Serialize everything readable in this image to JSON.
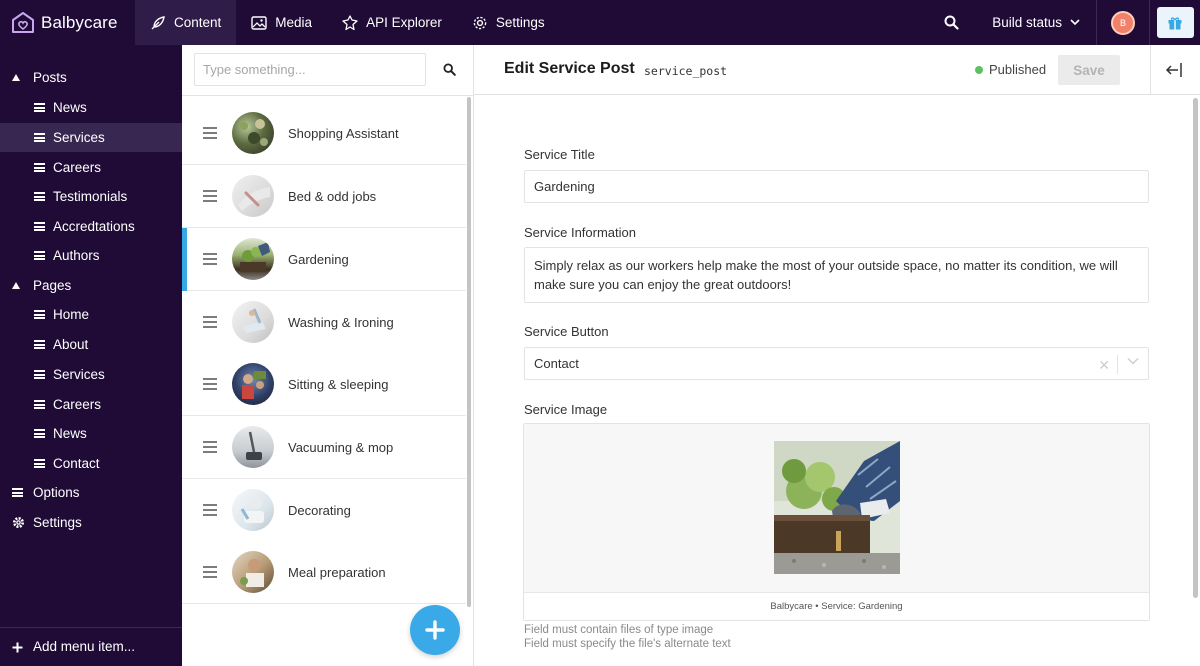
{
  "app": {
    "name": "Balbycare",
    "brand_color": "#1f0b36",
    "accent": "#36a8e6"
  },
  "topnav": [
    {
      "label": "Content",
      "icon": "feather-icon",
      "active": true
    },
    {
      "label": "Media",
      "icon": "image-icon"
    },
    {
      "label": "API Explorer",
      "icon": "api-explorer-icon"
    },
    {
      "label": "Settings",
      "icon": "gear-icon"
    }
  ],
  "topright": {
    "build_status": "Build status",
    "avatar_initial": "B"
  },
  "sidebar": {
    "items": [
      {
        "label": "Posts",
        "type": "group"
      },
      {
        "label": "News",
        "type": "child"
      },
      {
        "label": "Services",
        "type": "child",
        "active": true
      },
      {
        "label": "Careers",
        "type": "child"
      },
      {
        "label": "Testimonials",
        "type": "child"
      },
      {
        "label": "Accredtations",
        "type": "child"
      },
      {
        "label": "Authors",
        "type": "child"
      },
      {
        "label": "Pages",
        "type": "group"
      },
      {
        "label": "Home",
        "type": "child"
      },
      {
        "label": "About",
        "type": "child"
      },
      {
        "label": "Services",
        "type": "child"
      },
      {
        "label": "Careers",
        "type": "child"
      },
      {
        "label": "News",
        "type": "child"
      },
      {
        "label": "Contact",
        "type": "child"
      },
      {
        "label": "Options",
        "type": "top"
      },
      {
        "label": "Settings",
        "type": "top-gear"
      }
    ],
    "footer": "Add menu item..."
  },
  "list": {
    "search_placeholder": "Type something...",
    "items": [
      {
        "title": "Shopping Assistant"
      },
      {
        "title": "Bed & odd jobs"
      },
      {
        "title": "Gardening",
        "selected": true
      },
      {
        "title": "Washing & Ironing"
      },
      {
        "title": "Sitting & sleeping"
      },
      {
        "title": "Vacuuming & mop"
      },
      {
        "title": "Decorating"
      },
      {
        "title": "Meal preparation"
      }
    ]
  },
  "editor": {
    "title": "Edit Service Post",
    "api_key": "service_post",
    "status": "Published",
    "save_label": "Save",
    "fields": {
      "title_label": "Service Title",
      "title_value": "Gardening",
      "info_label": "Service Information",
      "info_value": "Simply relax as our workers help make the most of your outside space, no matter its condition, we will make sure you can enjoy the great outdoors!",
      "button_label": "Service Button",
      "button_value": "Contact",
      "image_label": "Service Image",
      "image_caption": "Balbycare • Service: Gardening"
    },
    "hints": [
      "Field must contain files of type image",
      "Field must specify the file's alternate text"
    ]
  }
}
